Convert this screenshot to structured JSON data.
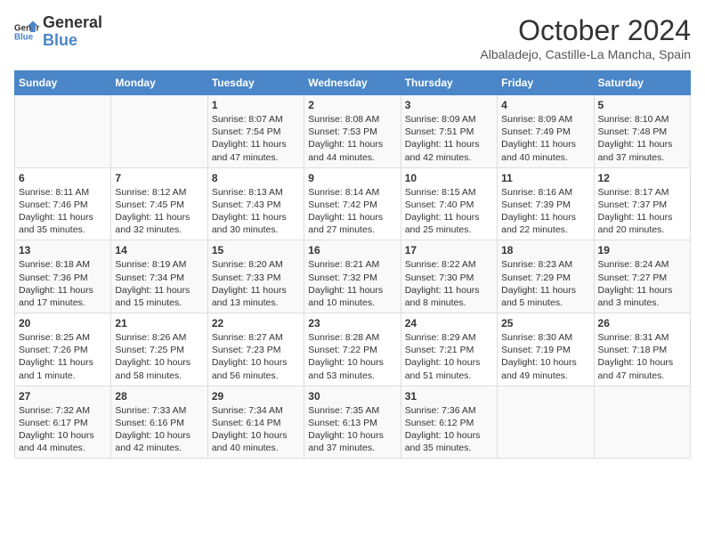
{
  "header": {
    "logo_general": "General",
    "logo_blue": "Blue",
    "month_title": "October 2024",
    "subtitle": "Albaladejo, Castille-La Mancha, Spain"
  },
  "weekdays": [
    "Sunday",
    "Monday",
    "Tuesday",
    "Wednesday",
    "Thursday",
    "Friday",
    "Saturday"
  ],
  "weeks": [
    [
      {
        "day": "",
        "content": ""
      },
      {
        "day": "",
        "content": ""
      },
      {
        "day": "1",
        "content": "Sunrise: 8:07 AM\nSunset: 7:54 PM\nDaylight: 11 hours and 47 minutes."
      },
      {
        "day": "2",
        "content": "Sunrise: 8:08 AM\nSunset: 7:53 PM\nDaylight: 11 hours and 44 minutes."
      },
      {
        "day": "3",
        "content": "Sunrise: 8:09 AM\nSunset: 7:51 PM\nDaylight: 11 hours and 42 minutes."
      },
      {
        "day": "4",
        "content": "Sunrise: 8:09 AM\nSunset: 7:49 PM\nDaylight: 11 hours and 40 minutes."
      },
      {
        "day": "5",
        "content": "Sunrise: 8:10 AM\nSunset: 7:48 PM\nDaylight: 11 hours and 37 minutes."
      }
    ],
    [
      {
        "day": "6",
        "content": "Sunrise: 8:11 AM\nSunset: 7:46 PM\nDaylight: 11 hours and 35 minutes."
      },
      {
        "day": "7",
        "content": "Sunrise: 8:12 AM\nSunset: 7:45 PM\nDaylight: 11 hours and 32 minutes."
      },
      {
        "day": "8",
        "content": "Sunrise: 8:13 AM\nSunset: 7:43 PM\nDaylight: 11 hours and 30 minutes."
      },
      {
        "day": "9",
        "content": "Sunrise: 8:14 AM\nSunset: 7:42 PM\nDaylight: 11 hours and 27 minutes."
      },
      {
        "day": "10",
        "content": "Sunrise: 8:15 AM\nSunset: 7:40 PM\nDaylight: 11 hours and 25 minutes."
      },
      {
        "day": "11",
        "content": "Sunrise: 8:16 AM\nSunset: 7:39 PM\nDaylight: 11 hours and 22 minutes."
      },
      {
        "day": "12",
        "content": "Sunrise: 8:17 AM\nSunset: 7:37 PM\nDaylight: 11 hours and 20 minutes."
      }
    ],
    [
      {
        "day": "13",
        "content": "Sunrise: 8:18 AM\nSunset: 7:36 PM\nDaylight: 11 hours and 17 minutes."
      },
      {
        "day": "14",
        "content": "Sunrise: 8:19 AM\nSunset: 7:34 PM\nDaylight: 11 hours and 15 minutes."
      },
      {
        "day": "15",
        "content": "Sunrise: 8:20 AM\nSunset: 7:33 PM\nDaylight: 11 hours and 13 minutes."
      },
      {
        "day": "16",
        "content": "Sunrise: 8:21 AM\nSunset: 7:32 PM\nDaylight: 11 hours and 10 minutes."
      },
      {
        "day": "17",
        "content": "Sunrise: 8:22 AM\nSunset: 7:30 PM\nDaylight: 11 hours and 8 minutes."
      },
      {
        "day": "18",
        "content": "Sunrise: 8:23 AM\nSunset: 7:29 PM\nDaylight: 11 hours and 5 minutes."
      },
      {
        "day": "19",
        "content": "Sunrise: 8:24 AM\nSunset: 7:27 PM\nDaylight: 11 hours and 3 minutes."
      }
    ],
    [
      {
        "day": "20",
        "content": "Sunrise: 8:25 AM\nSunset: 7:26 PM\nDaylight: 11 hours and 1 minute."
      },
      {
        "day": "21",
        "content": "Sunrise: 8:26 AM\nSunset: 7:25 PM\nDaylight: 10 hours and 58 minutes."
      },
      {
        "day": "22",
        "content": "Sunrise: 8:27 AM\nSunset: 7:23 PM\nDaylight: 10 hours and 56 minutes."
      },
      {
        "day": "23",
        "content": "Sunrise: 8:28 AM\nSunset: 7:22 PM\nDaylight: 10 hours and 53 minutes."
      },
      {
        "day": "24",
        "content": "Sunrise: 8:29 AM\nSunset: 7:21 PM\nDaylight: 10 hours and 51 minutes."
      },
      {
        "day": "25",
        "content": "Sunrise: 8:30 AM\nSunset: 7:19 PM\nDaylight: 10 hours and 49 minutes."
      },
      {
        "day": "26",
        "content": "Sunrise: 8:31 AM\nSunset: 7:18 PM\nDaylight: 10 hours and 47 minutes."
      }
    ],
    [
      {
        "day": "27",
        "content": "Sunrise: 7:32 AM\nSunset: 6:17 PM\nDaylight: 10 hours and 44 minutes."
      },
      {
        "day": "28",
        "content": "Sunrise: 7:33 AM\nSunset: 6:16 PM\nDaylight: 10 hours and 42 minutes."
      },
      {
        "day": "29",
        "content": "Sunrise: 7:34 AM\nSunset: 6:14 PM\nDaylight: 10 hours and 40 minutes."
      },
      {
        "day": "30",
        "content": "Sunrise: 7:35 AM\nSunset: 6:13 PM\nDaylight: 10 hours and 37 minutes."
      },
      {
        "day": "31",
        "content": "Sunrise: 7:36 AM\nSunset: 6:12 PM\nDaylight: 10 hours and 35 minutes."
      },
      {
        "day": "",
        "content": ""
      },
      {
        "day": "",
        "content": ""
      }
    ]
  ]
}
